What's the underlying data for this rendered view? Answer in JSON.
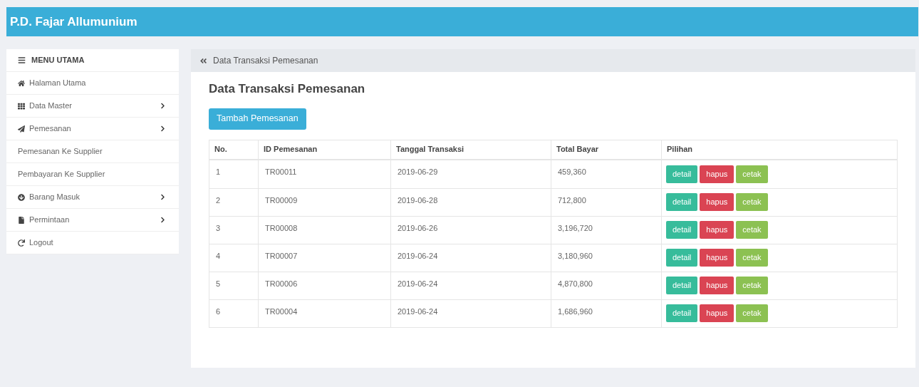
{
  "header": {
    "title": "P.D. Fajar Allumunium"
  },
  "sidebar": {
    "heading": "MENU UTAMA",
    "items": [
      {
        "label": "Halaman Utama",
        "kind": "home",
        "has_submenu": false
      },
      {
        "label": "Data Master",
        "kind": "grid",
        "has_submenu": true
      },
      {
        "label": "Pemesanan",
        "kind": "send",
        "has_submenu": true
      },
      {
        "label": "Pemesanan Ke Supplier",
        "kind": "plain",
        "has_submenu": false
      },
      {
        "label": "Pembayaran Ke Supplier",
        "kind": "plain",
        "has_submenu": false
      },
      {
        "label": "Barang Masuk",
        "kind": "download",
        "has_submenu": true
      },
      {
        "label": "Permintaan",
        "kind": "file",
        "has_submenu": true
      },
      {
        "label": "Logout",
        "kind": "logout",
        "has_submenu": false
      }
    ]
  },
  "breadcrumb": "Data Transaksi Pemesanan",
  "page_title": "Data Transaksi Pemesanan",
  "add_button": "Tambah Pemesanan",
  "table": {
    "columns": [
      "No.",
      "ID Pemesanan",
      "Tanggal Transaksi",
      "Total Bayar",
      "Pilihan"
    ],
    "rows": [
      {
        "no": "1",
        "id": "TR00011",
        "date": "2019-06-29",
        "total": "459,360",
        "actions": [
          {
            "label": "detail",
            "kind": "detail"
          },
          {
            "label": "hapus",
            "kind": "delete"
          },
          {
            "label": "cetak",
            "kind": "print"
          }
        ]
      },
      {
        "no": "2",
        "id": "TR00009",
        "date": "2019-06-28",
        "total": "712,800",
        "actions": [
          {
            "label": "detail",
            "kind": "detail"
          },
          {
            "label": "hapus",
            "kind": "delete"
          },
          {
            "label": "cetak",
            "kind": "print"
          }
        ]
      },
      {
        "no": "3",
        "id": "TR00008",
        "date": "2019-06-26",
        "total": "3,196,720",
        "actions": [
          {
            "label": "detail",
            "kind": "detail"
          },
          {
            "label": "hapus",
            "kind": "delete"
          },
          {
            "label": "cetak",
            "kind": "print"
          }
        ]
      },
      {
        "no": "4",
        "id": "TR00007",
        "date": "2019-06-24",
        "total": "3,180,960",
        "actions": [
          {
            "label": "detail",
            "kind": "detail"
          },
          {
            "label": "hapus",
            "kind": "delete"
          },
          {
            "label": "cetak",
            "kind": "print"
          }
        ]
      },
      {
        "no": "5",
        "id": "TR00006",
        "date": "2019-06-24",
        "total": "4,870,800",
        "actions": [
          {
            "label": "detail",
            "kind": "detail"
          },
          {
            "label": "hapus",
            "kind": "delete"
          },
          {
            "label": "cetak",
            "kind": "print"
          }
        ]
      },
      {
        "no": "6",
        "id": "TR00004",
        "date": "2019-06-24",
        "total": "1,686,960",
        "actions": [
          {
            "label": "detail",
            "kind": "detail"
          },
          {
            "label": "hapus",
            "kind": "delete"
          },
          {
            "label": "cetak",
            "kind": "print"
          }
        ]
      }
    ]
  }
}
